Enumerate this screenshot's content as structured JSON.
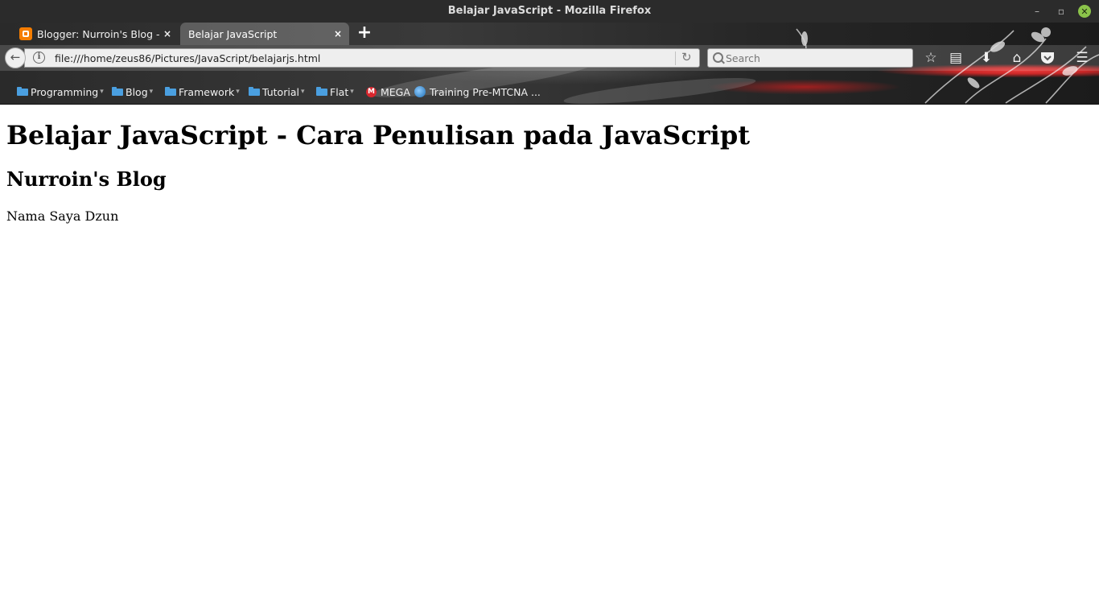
{
  "window": {
    "title": "Belajar JavaScript - Mozilla Firefox",
    "controls": [
      "minimize-icon",
      "restore-icon",
      "close-icon"
    ]
  },
  "tabs": [
    {
      "label": "Blogger: Nurroin's Blog - Bl",
      "icon": "blogger-icon",
      "close": "×",
      "active": false
    },
    {
      "label": "Belajar JavaScript",
      "close": "×",
      "active": true
    }
  ],
  "new_tab_label": "+",
  "navbar": {
    "url": "file:///home/zeus86/Pictures/JavaScript/belajarjs.html",
    "search_placeholder": "Search",
    "buttons": [
      "back-icon",
      "info-icon",
      "reload-icon",
      "bookmark-star-icon",
      "reading-list-icon",
      "download-icon",
      "home-icon",
      "pocket-icon",
      "menu-icon"
    ]
  },
  "bookmarks": [
    {
      "label": "Programming",
      "type": "folder"
    },
    {
      "label": "Blog",
      "type": "folder"
    },
    {
      "label": "Framework",
      "type": "folder"
    },
    {
      "label": "Tutorial",
      "type": "folder"
    },
    {
      "label": "Flat",
      "type": "folder"
    },
    {
      "label": "MEGA",
      "type": "link",
      "icon": "mega-icon",
      "icon_text": "M"
    },
    {
      "label": "Training Pre-MTCNA ...",
      "type": "link",
      "icon": "globe-icon"
    }
  ],
  "page": {
    "heading": "Belajar JavaScript - Cara Penulisan pada JavaScript",
    "subheading": "Nurroin's Blog",
    "paragraph": "Nama Saya Dzun"
  },
  "colors": {
    "titlebar": "#2b2b2b",
    "theme_red": "#e83a3a",
    "folder_blue": "#4a9fe0",
    "close_button": "#8bc34a"
  }
}
